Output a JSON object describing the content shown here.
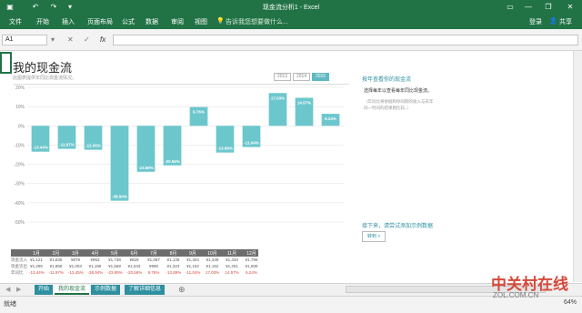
{
  "window": {
    "title": "现金流分析1 - Excel"
  },
  "ribbon": {
    "tabs": [
      "文件",
      "开始",
      "插入",
      "页面布局",
      "公式",
      "数据",
      "审阅",
      "视图"
    ],
    "tell_me": "告诉我您想要做什么...",
    "login": "登录",
    "share": "共享"
  },
  "formula_bar": {
    "name_box": "A1",
    "fx_label": "fx"
  },
  "sheet": {
    "title": "我的现金流",
    "subtitle": "此图表提供年同比现金流情况。",
    "years": [
      "2013",
      "2014",
      "2015"
    ],
    "selected_year": "2015",
    "side_heading": "按年查看你的现金流",
    "side_text": "选择每年以查看每年同比现金流。",
    "side_note": "（年同比将依据和你同期的收入与去年同一时间的结果相比较。）",
    "side_heading2": "接下来，请尝试添加示例数据",
    "see_button": "转到 >"
  },
  "chart_data": {
    "type": "bar",
    "categories": [
      "1月",
      "2月",
      "3月",
      "4月",
      "5月",
      "6月",
      "7月",
      "8月",
      "9月",
      "10月",
      "11月",
      "12月"
    ],
    "values": [
      -13.44,
      -11.97,
      -12.45,
      -38.94,
      -23.89,
      -20.56,
      9.76,
      -13.89,
      -11.04,
      17.03,
      14.57,
      6.24
    ],
    "data_labels": [
      "-13.44%",
      "-11.97%",
      "-12.45%",
      "-38.94%",
      "-23.89%",
      "-20.56%",
      "9.76%",
      "-13.89%",
      "-11.04%",
      "17.03%",
      "14.57%",
      "6.24%"
    ],
    "y_ticks": [
      "20%",
      "10%",
      "0%",
      "-10%",
      "-20%",
      "-30%",
      "-40%",
      "-50%"
    ],
    "ylim": [
      -50,
      20
    ],
    "bar_color": "#6cc7cd",
    "grid": true
  },
  "table": {
    "corner": "",
    "row_labels": [
      "现金流入",
      "现金流出",
      "年同比"
    ],
    "months": [
      "1月",
      "2月",
      "3月",
      "4月",
      "5月",
      "6月",
      "7月",
      "8月",
      "9月",
      "10月",
      "11月",
      "12月"
    ],
    "rows": [
      [
        "¥1,121",
        "¥1,636",
        "¥878",
        "¥953",
        "¥1,738",
        "¥829",
        "¥1,087",
        "¥1,139",
        "¥1,404",
        "¥1,349",
        "¥1,433",
        "¥1,796"
      ],
      [
        "¥1,295",
        "¥1,858",
        "¥1,003",
        "¥1,196",
        "¥1,569",
        "¥1,043",
        "¥990",
        "¥1,323",
        "¥1,152",
        "¥1,152",
        "¥1,251",
        "¥1,690"
      ],
      [
        "-13.44%",
        "-11.97%",
        "-12.45%",
        "-38.94%",
        "-23.89%",
        "-20.56%",
        "9.76%",
        "-13.89%",
        "-11.04%",
        "17.03%",
        "14.57%",
        "6.24%"
      ]
    ]
  },
  "sheet_tabs": [
    "开始",
    "我的现金流",
    "示例数据",
    "了解详细信息"
  ],
  "active_tab": "我的现金流",
  "status": {
    "ready": "就绪",
    "zoom": "64%"
  },
  "watermark": {
    "line1": "中关村在线",
    "line2": "ZOL.COM.CN"
  },
  "colors": {
    "excel_green": "#217346",
    "accent_teal": "#2d8fa0"
  }
}
